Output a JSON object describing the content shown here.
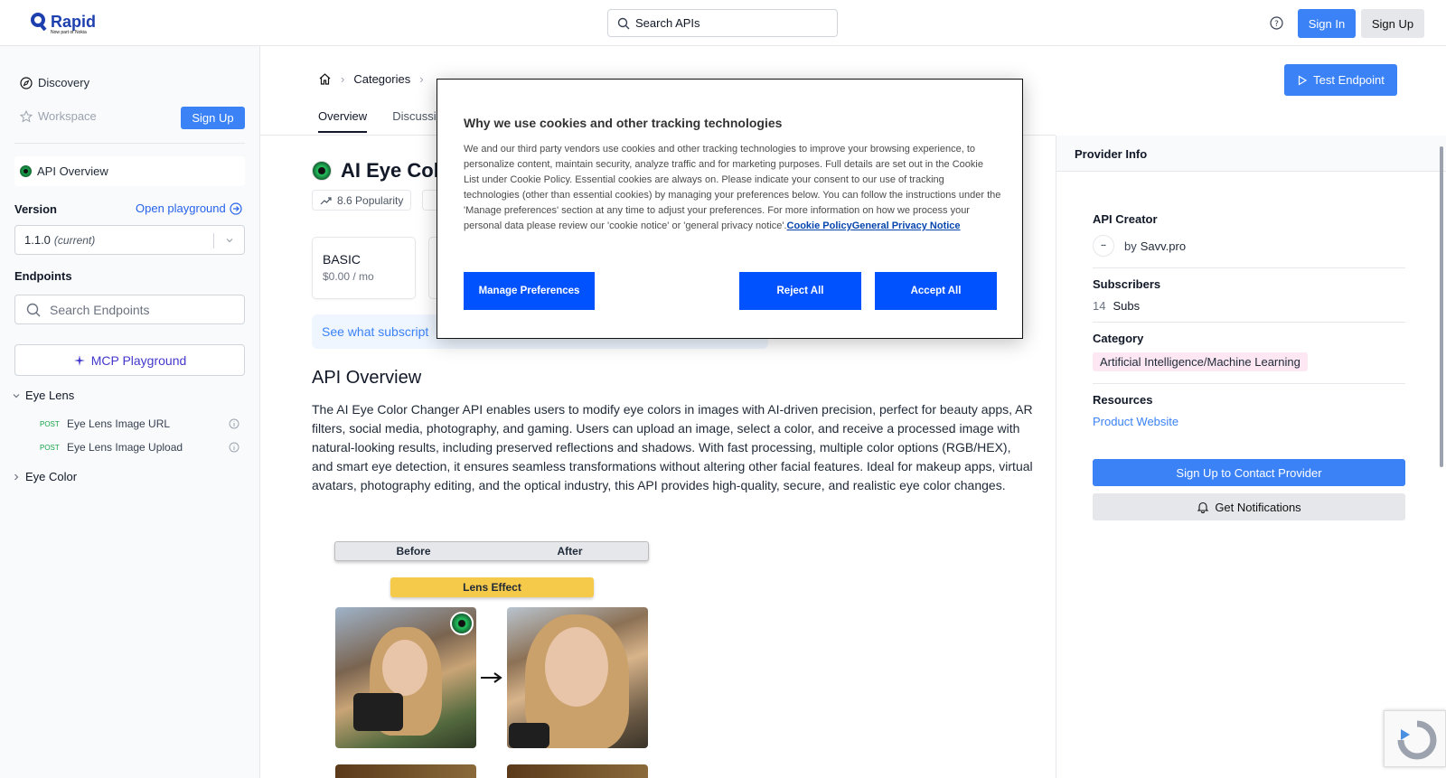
{
  "header": {
    "logo_name": "Rapid",
    "logo_sub": "Now part of Nokia",
    "search_placeholder": "Search APIs",
    "sign_in": "Sign In",
    "sign_up": "Sign Up"
  },
  "sidebar": {
    "discovery": "Discovery",
    "workspace": "Workspace",
    "workspace_signup": "Sign Up",
    "api_overview": "API Overview",
    "version_label": "Version",
    "open_playground": "Open playground",
    "version_value": "1.1.0",
    "version_current": "(current)",
    "endpoints_label": "Endpoints",
    "search_endpoints": "Search Endpoints",
    "mcp_playground": "MCP Playground",
    "groups": [
      {
        "name": "Eye Lens",
        "expanded": true
      },
      {
        "name": "Eye Color",
        "expanded": false
      }
    ],
    "endpoints": [
      {
        "method": "POST",
        "name": "Eye Lens Image URL"
      },
      {
        "method": "POST",
        "name": "Eye Lens Image Upload"
      }
    ]
  },
  "main": {
    "breadcrumb_categories": "Categories",
    "test_endpoint": "Test Endpoint",
    "tabs": [
      "Overview",
      "Discussi"
    ],
    "title": "AI Eye Col",
    "popularity": "8.6 Popularity",
    "plan_name": "BASIC",
    "plan_price": "$0.00 / mo",
    "subscription_link": "See what subscript",
    "overview_heading": "API Overview",
    "overview_text": "The AI Eye Color Changer API enables users to modify eye colors in images with AI-driven precision, perfect for beauty apps, AR filters, social media, photography, and gaming. Users can upload an image, select a color, and receive a processed image with natural-looking results, including preserved reflections and shadows. With fast processing, multiple color options (RGB/HEX), and smart eye detection, it ensures seamless transformations without altering other facial features. Ideal for makeup apps, virtual avatars, photography editing, and the optical industry, this API provides high-quality, secure, and realistic eye color changes.",
    "image_before": "Before",
    "image_after": "After",
    "image_lens": "Lens Effect"
  },
  "provider": {
    "header": "Provider Info",
    "creator_label": "API Creator",
    "creator_by": "by",
    "creator_name": "Savv.pro",
    "subscribers_label": "Subscribers",
    "subscribers_count": "14",
    "subscribers_unit": "Subs",
    "category_label": "Category",
    "category_value": "Artificial Intelligence/Machine Learning",
    "resources_label": "Resources",
    "product_website": "Product Website",
    "contact_button": "Sign Up to Contact Provider",
    "notifications_button": "Get Notifications"
  },
  "cookie_modal": {
    "title": "Why we use cookies and other tracking technologies",
    "body": "We and our third party vendors use cookies and other tracking technologies to improve your browsing experience, to personalize content, maintain security, analyze traffic and for marketing purposes. Full details are set out in the Cookie List under Cookie Policy. Essential cookies are always on. Please indicate your consent to our use of tracking technologies (other than essential cookies) by managing your preferences below. You can follow the instructions under the 'Manage preferences' section at any time to adjust your preferences. For more information on how we process your personal data please review our 'cookie notice' or 'general privacy notice'.",
    "link_cookie_policy": "Cookie Policy",
    "link_privacy": "General Privacy Notice",
    "manage": "Manage Preferences",
    "reject": "Reject All",
    "accept": "Accept All"
  },
  "colors": {
    "primary": "#3b82f6",
    "modal_button": "#0052ff",
    "category_chip": "#fce7f3"
  }
}
